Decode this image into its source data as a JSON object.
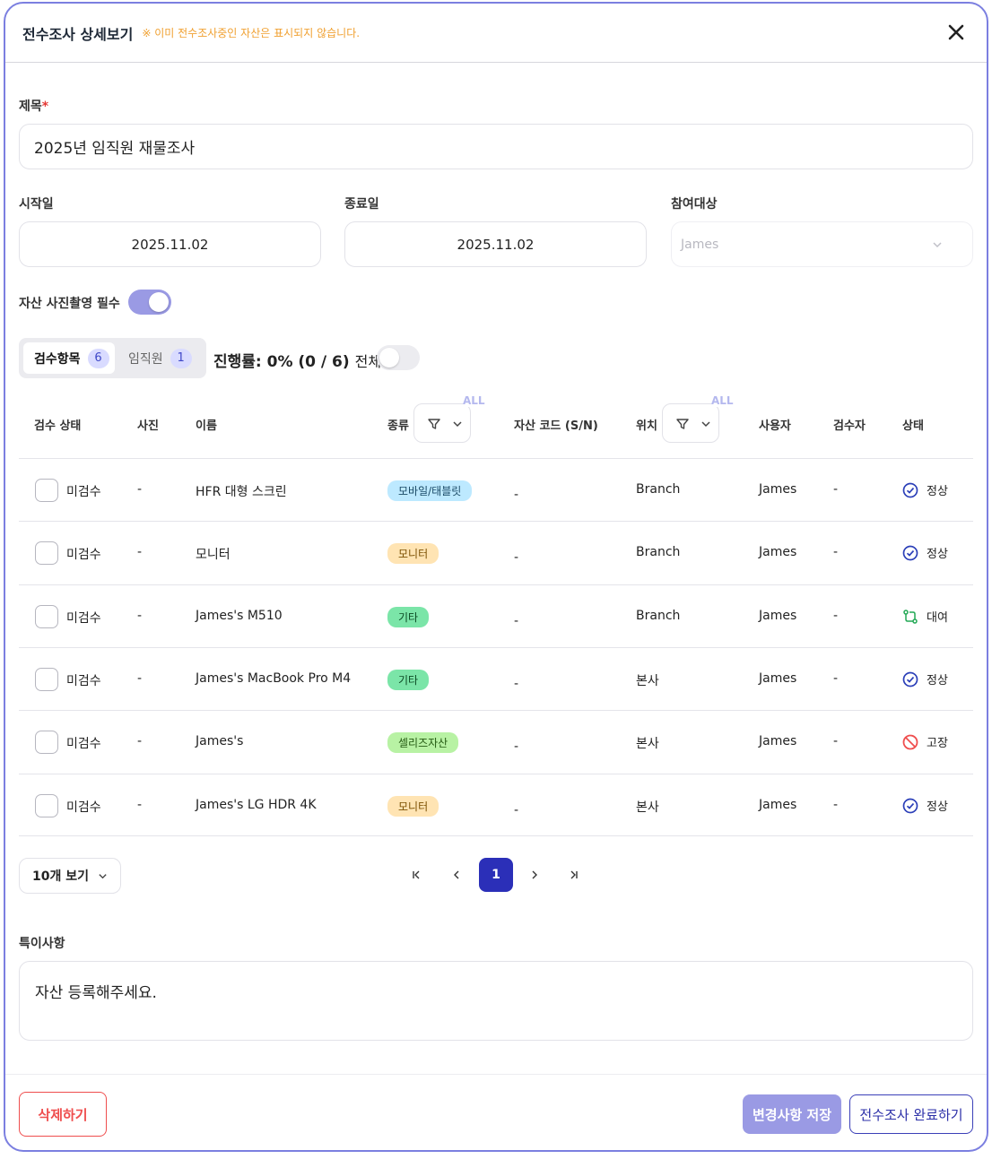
{
  "header": {
    "title": "전수조사 상세보기",
    "notice": "※ 이미 전수조사중인 자산은 표시되지 않습니다.",
    "close_icon": "close-icon"
  },
  "form": {
    "title_label": "제목",
    "title_required": "*",
    "title_value": "2025년 임직원 재물조사",
    "start_label": "시작일",
    "start_value": "2025.11.02",
    "end_label": "종료일",
    "end_value": "2025.11.02",
    "participants_label": "참여대상",
    "participants_value": "James",
    "photo_required_label": "자산 사진촬영 필수",
    "photo_required_on": true
  },
  "tabs": [
    {
      "label": "검수항목",
      "count": "6",
      "active": true
    },
    {
      "label": "임직원",
      "count": "1",
      "active": false
    }
  ],
  "progress": {
    "text": "진행률: 0% (0 / 6)",
    "all_label": "전체",
    "all_on": false
  },
  "table": {
    "headers": {
      "check_status": "검수 상태",
      "photo": "사진",
      "name": "이름",
      "type": "종류",
      "code": "자산 코드 (S/N)",
      "location": "위치",
      "user": "사용자",
      "inspector": "검수자",
      "status": "상태"
    },
    "filter_badge": "ALL",
    "rows": [
      {
        "check": "미검수",
        "photo": "-",
        "name": "HFR 대형 스크린",
        "type": "모바일/태블릿",
        "code": "-",
        "location": "Branch",
        "user": "James",
        "inspector": "-",
        "status": "정상"
      },
      {
        "check": "미검수",
        "photo": "-",
        "name": "모니터",
        "type": "모니터",
        "code": "-",
        "location": "Branch",
        "user": "James",
        "inspector": "-",
        "status": "정상"
      },
      {
        "check": "미검수",
        "photo": "-",
        "name": "James's M510",
        "type": "기타",
        "code": "-",
        "location": "Branch",
        "user": "James",
        "inspector": "-",
        "status": "대여"
      },
      {
        "check": "미검수",
        "photo": "-",
        "name": "James's MacBook Pro M4",
        "type": "기타",
        "code": "-",
        "location": "본사",
        "user": "James",
        "inspector": "-",
        "status": "정상"
      },
      {
        "check": "미검수",
        "photo": "-",
        "name": "James's",
        "type": "셀리즈자산",
        "code": "-",
        "location": "본사",
        "user": "James",
        "inspector": "-",
        "status": "고장"
      },
      {
        "check": "미검수",
        "photo": "-",
        "name": "James's LG HDR 4K",
        "type": "모니터",
        "code": "-",
        "location": "본사",
        "user": "James",
        "inspector": "-",
        "status": "정상"
      }
    ]
  },
  "pagination": {
    "per_page": "10개 보기",
    "current": "1"
  },
  "memo": {
    "label": "특이사항",
    "value": "자산 등록해주세요."
  },
  "footer": {
    "delete": "삭제하기",
    "save": "변경사항 저장",
    "complete": "전수조사 완료하기"
  },
  "colors": {
    "accent": "#2b2fb8",
    "border": "#7b7fe0",
    "danger": "#ef4e4e",
    "ok": "#2b3fb8",
    "rent": "#22a855"
  }
}
